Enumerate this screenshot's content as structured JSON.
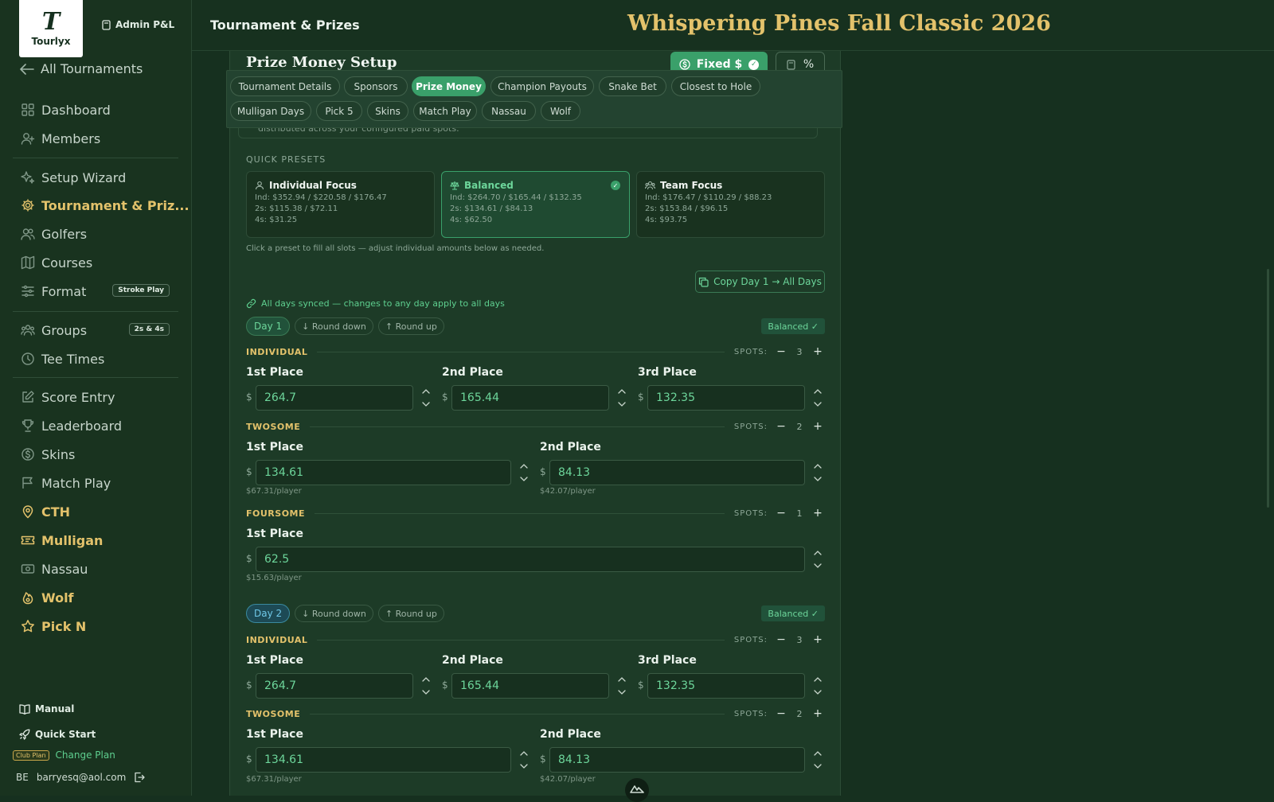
{
  "brand": {
    "logo_mark": "T",
    "logo_text": "Tourlyx",
    "admin_label": "Admin P&L"
  },
  "sidebar": {
    "back_label": "All Tournaments",
    "items": [
      {
        "label": "Dashboard",
        "icon": "grid-icon"
      },
      {
        "label": "Members",
        "icon": "user-add-icon"
      },
      {
        "label": "Setup Wizard",
        "icon": "sparkles-icon"
      },
      {
        "label": "Tournament & Priz...",
        "icon": "gear-icon",
        "active": true
      },
      {
        "label": "Golfers",
        "icon": "users-icon"
      },
      {
        "label": "Courses",
        "icon": "map-icon"
      },
      {
        "label": "Format",
        "icon": "sliders-icon",
        "badge": "Stroke Play"
      },
      {
        "label": "Groups",
        "icon": "groups-icon",
        "badge": "2s & 4s"
      },
      {
        "label": "Tee Times",
        "icon": "clock-icon"
      },
      {
        "label": "Score Entry",
        "icon": "edit-icon"
      },
      {
        "label": "Leaderboard",
        "icon": "trophy-icon"
      },
      {
        "label": "Skins",
        "icon": "dollar-icon"
      },
      {
        "label": "Match Play",
        "icon": "flag-icon"
      },
      {
        "label": "CTH",
        "icon": "pin-icon"
      },
      {
        "label": "Mulligan",
        "icon": "ticket-icon"
      },
      {
        "label": "Nassau",
        "icon": "cash-icon"
      },
      {
        "label": "Wolf",
        "icon": "flame-icon"
      },
      {
        "label": "Pick N",
        "icon": "star-icon"
      }
    ],
    "manual_label": "Manual",
    "quick_start_label": "Quick Start",
    "plan_badge": "Club Plan",
    "change_plan_label": "Change Plan",
    "user_initials": "BE",
    "user_email": "barryesq@aol.com"
  },
  "header": {
    "page_title": "Tournament & Prizes",
    "event_title": "Whispering Pines Fall Classic 2026"
  },
  "card": {
    "title": "Prize Money Setup",
    "fixed_label": "Fixed $",
    "percent_label": "%",
    "note": "distributed across your configured paid spots.",
    "quick_presets_label": "QUICK PRESETS",
    "presets": [
      {
        "title": "Individual Focus",
        "icon": "user-icon",
        "lines": [
          "Ind: $352.94 / $220.58 / $176.47",
          "2s: $115.38 / $72.11",
          "4s: $31.25"
        ]
      },
      {
        "title": "Balanced",
        "icon": "scale-icon",
        "selected": true,
        "lines": [
          "Ind: $264.70 / $165.44 / $132.35",
          "2s: $134.61 / $84.13",
          "4s: $62.50"
        ]
      },
      {
        "title": "Team Focus",
        "icon": "team-icon",
        "lines": [
          "Ind: $176.47 / $110.29 / $88.23",
          "2s: $153.84 / $96.15",
          "4s: $93.75"
        ]
      }
    ],
    "preset_hint": "Click a preset to fill all slots — adjust individual amounts below as needed.",
    "copy_label": "Copy Day 1 → All Days",
    "sync_label": "All days synced — changes to any day apply to all days",
    "spots_label": "SPOTS:",
    "round_down": "Round down",
    "round_up": "Round up",
    "balanced_badge": "Balanced ✓",
    "days": [
      {
        "label": "Day 1",
        "individual": {
          "title": "INDIVIDUAL",
          "spots": "3",
          "places": [
            {
              "label": "1st Place",
              "value": "264.7"
            },
            {
              "label": "2nd Place",
              "value": "165.44"
            },
            {
              "label": "3rd Place",
              "value": "132.35"
            }
          ]
        },
        "twosome": {
          "title": "TWOSOME",
          "spots": "2",
          "places": [
            {
              "label": "1st Place",
              "value": "134.61",
              "per": "$67.31/player"
            },
            {
              "label": "2nd Place",
              "value": "84.13",
              "per": "$42.07/player"
            }
          ]
        },
        "foursome": {
          "title": "FOURSOME",
          "spots": "1",
          "places": [
            {
              "label": "1st Place",
              "value": "62.5",
              "per": "$15.63/player"
            }
          ]
        }
      },
      {
        "label": "Day 2",
        "individual": {
          "title": "INDIVIDUAL",
          "spots": "3",
          "places": [
            {
              "label": "1st Place",
              "value": "264.7"
            },
            {
              "label": "2nd Place",
              "value": "165.44"
            },
            {
              "label": "3rd Place",
              "value": "132.35"
            }
          ]
        },
        "twosome": {
          "title": "TWOSOME",
          "spots": "2",
          "places": [
            {
              "label": "1st Place",
              "value": "134.61",
              "per": "$67.31/player"
            },
            {
              "label": "2nd Place",
              "value": "84.13",
              "per": "$42.07/player"
            }
          ]
        }
      }
    ]
  },
  "tabs": [
    {
      "label": "Tournament Details"
    },
    {
      "label": "Sponsors"
    },
    {
      "label": "Prize Money",
      "selected": true
    },
    {
      "label": "Champion Payouts"
    },
    {
      "label": "Snake Bet"
    },
    {
      "label": "Closest to Hole"
    },
    {
      "label": "Mulligan Days"
    },
    {
      "label": "Pick 5"
    },
    {
      "label": "Skins"
    },
    {
      "label": "Match Play"
    },
    {
      "label": "Nassau"
    },
    {
      "label": "Wolf"
    }
  ],
  "colors": {
    "background": "#16301f",
    "accent": "#3aa06a",
    "gold": "#e3c26b",
    "value_green": "#6dd69b"
  }
}
